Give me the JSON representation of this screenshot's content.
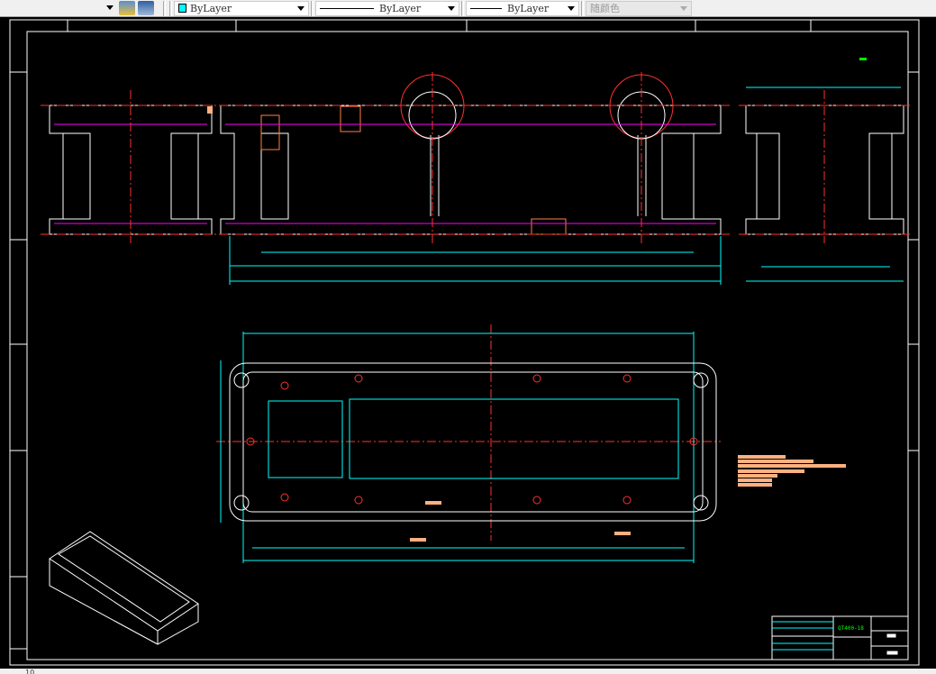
{
  "toolbar": {
    "layer_icons": [
      "layer-previous-icon",
      "layer-state-icon"
    ],
    "color": {
      "label": "ByLayer",
      "swatch": "#00ffff"
    },
    "linetype": {
      "label": "ByLayer"
    },
    "lineweight": {
      "label": "ByLayer"
    },
    "plot_style": {
      "label": "随颜色"
    }
  },
  "drawing": {
    "background": "#000000",
    "title_block": {
      "drawing_number": "QT400-18"
    },
    "colors": {
      "outline": "#ffffff",
      "dimension": "#00ffff",
      "centerline": "#ff3030",
      "hidden": "#ff00ff",
      "text": "#ffb080",
      "title": "#00ff00"
    }
  },
  "statusbar": {
    "text": "10"
  }
}
